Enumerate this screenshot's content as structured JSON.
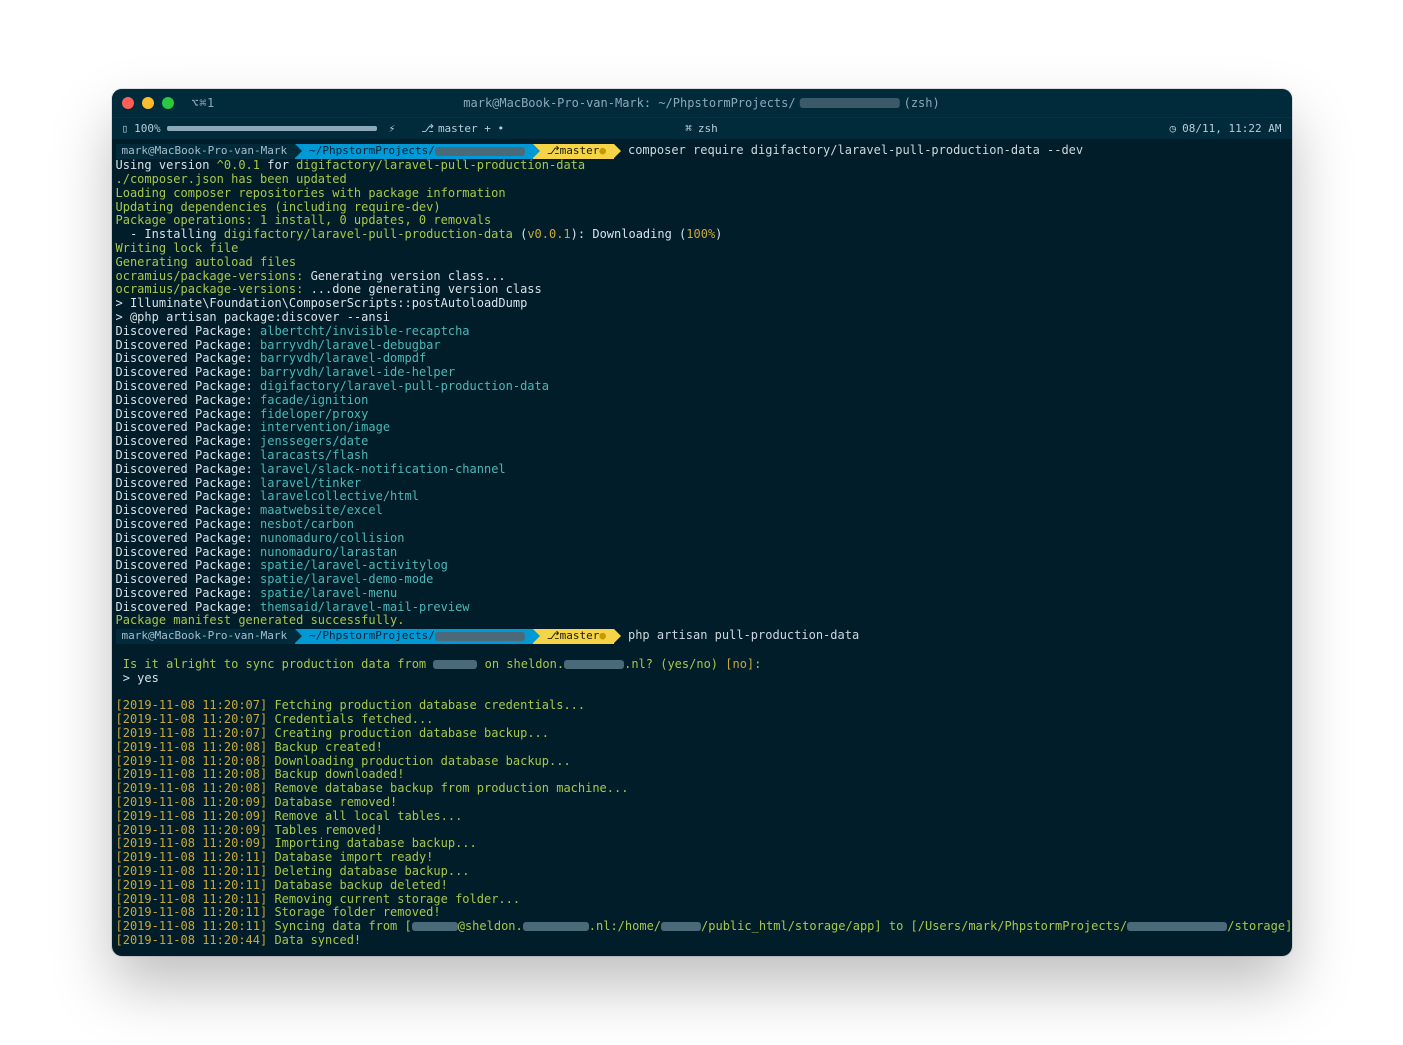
{
  "titlebar": {
    "tab": "⌥⌘1",
    "prefix": "mark@MacBook-Pro-van-Mark: ~/PhpstormProjects/",
    "suffix": " (zsh)"
  },
  "statusbar": {
    "battery": "100%",
    "branch": "master + •",
    "shell": "zsh",
    "clock": "08/11, 11:22 AM"
  },
  "prompt1": {
    "user": "mark@MacBook-Pro-van-Mark",
    "path": " ~/PhpstormProjects/",
    "branch": "master ",
    "cmd": "composer require digifactory/laravel-pull-production-data --dev"
  },
  "out": {
    "l1a": "Using version ",
    "l1b": "^0.0.1",
    "l1c": " for ",
    "l1d": "digifactory/laravel-pull-production-data",
    "l2": "./composer.json has been updated",
    "l3": "Loading composer repositories with package information",
    "l4": "Updating dependencies (including require-dev)",
    "l5": "Package operations: 1 install, 0 updates, 0 removals",
    "l6a": "  - Installing ",
    "l6b": "digifactory/laravel-pull-production-data",
    "l6c": " (",
    "l6d": "v0.0.1",
    "l6e": "): Downloading (",
    "l6f": "100%",
    "l6g": ")",
    "l7": "Writing lock file",
    "l8": "Generating autoload files",
    "l9a": "ocramius/package-versions:",
    "l9b": " Generating version class...",
    "l10a": "ocramius/package-versions:",
    "l10b": " ...done generating version class",
    "l11": "> Illuminate\\Foundation\\ComposerScripts::postAutoloadDump",
    "l12": "> @php artisan package:discover --ansi",
    "disc": "Discovered Package: ",
    "pkgs": [
      "albertcht/invisible-recaptcha",
      "barryvdh/laravel-debugbar",
      "barryvdh/laravel-dompdf",
      "barryvdh/laravel-ide-helper",
      "digifactory/laravel-pull-production-data",
      "facade/ignition",
      "fideloper/proxy",
      "intervention/image",
      "jenssegers/date",
      "laracasts/flash",
      "laravel/slack-notification-channel",
      "laravel/tinker",
      "laravelcollective/html",
      "maatwebsite/excel",
      "nesbot/carbon",
      "nunomaduro/collision",
      "nunomaduro/larastan",
      "spatie/laravel-activitylog",
      "spatie/laravel-demo-mode",
      "spatie/laravel-menu",
      "themsaid/laravel-mail-preview"
    ],
    "manifest": "Package manifest generated successfully."
  },
  "prompt2": {
    "user": "mark@MacBook-Pro-van-Mark",
    "path": " ~/PhpstormProjects/",
    "branch": "master ",
    "cmd": "php artisan pull-production-data"
  },
  "sync": {
    "q1": " Is it alright to sync production data from ",
    "q2": " on sheldon.",
    "q3": ".nl? (yes/no) ",
    "q4": "[no]",
    "q5": ":",
    "ans": " > yes"
  },
  "logs": [
    {
      "ts": "[2019-11-08 11:20:07]",
      "msg": "Fetching production database credentials..."
    },
    {
      "ts": "[2019-11-08 11:20:07]",
      "msg": "Credentials fetched..."
    },
    {
      "ts": "[2019-11-08 11:20:07]",
      "msg": "Creating production database backup..."
    },
    {
      "ts": "[2019-11-08 11:20:08]",
      "msg": "Backup created!"
    },
    {
      "ts": "[2019-11-08 11:20:08]",
      "msg": "Downloading production database backup..."
    },
    {
      "ts": "[2019-11-08 11:20:08]",
      "msg": "Backup downloaded!"
    },
    {
      "ts": "[2019-11-08 11:20:08]",
      "msg": "Remove database backup from production machine..."
    },
    {
      "ts": "[2019-11-08 11:20:09]",
      "msg": "Database removed!"
    },
    {
      "ts": "[2019-11-08 11:20:09]",
      "msg": "Remove all local tables..."
    },
    {
      "ts": "[2019-11-08 11:20:09]",
      "msg": "Tables removed!"
    },
    {
      "ts": "[2019-11-08 11:20:09]",
      "msg": "Importing database backup..."
    },
    {
      "ts": "[2019-11-08 11:20:11]",
      "msg": "Database import ready!"
    },
    {
      "ts": "[2019-11-08 11:20:11]",
      "msg": "Deleting database backup..."
    },
    {
      "ts": "[2019-11-08 11:20:11]",
      "msg": "Database backup deleted!"
    },
    {
      "ts": "[2019-11-08 11:20:11]",
      "msg": "Removing current storage folder..."
    },
    {
      "ts": "[2019-11-08 11:20:11]",
      "msg": "Storage folder removed!"
    }
  ],
  "syncline": {
    "ts": "[2019-11-08 11:20:11]",
    "a": "Syncing data from [",
    "b": "@sheldon.",
    "c": ".nl:/home/",
    "d": "/public_html/storage/app] to [/Users/mark/PhpstormProjects/",
    "e": "/storage]..."
  },
  "final": {
    "ts": "[2019-11-08 11:20:44]",
    "msg": "Data synced!"
  }
}
